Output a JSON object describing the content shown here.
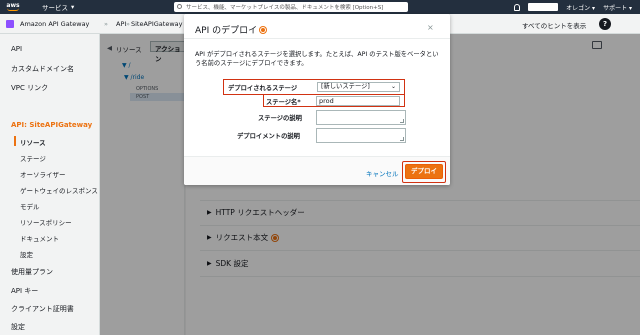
{
  "topnav": {
    "logo": "aws",
    "services": "サービス",
    "search_placeholder": "サービス、機能、マーケットプレイスの製品、ドキュメントを検索 [Option+S]",
    "support": "サポート",
    "region": "オレゴン"
  },
  "breadcrumb": {
    "service": "Amazon API Gateway",
    "api": "API",
    "separator": "»",
    "api_name": "SiteAPIGateway (e",
    "hints": "すべてのヒントを表示",
    "help": "?"
  },
  "sidebar": {
    "items": [
      {
        "label": "API"
      },
      {
        "label": "カスタムドメイン名"
      },
      {
        "label": "VPC リンク"
      }
    ],
    "api_heading": "API: SiteAPIGateway",
    "sub_items": [
      {
        "label": "リソース"
      },
      {
        "label": "ステージ"
      },
      {
        "label": "オーソライザー"
      },
      {
        "label": "ゲートウェイのレスポンス"
      },
      {
        "label": "モデル"
      },
      {
        "label": "リソースポリシー"
      },
      {
        "label": "ドキュメント"
      },
      {
        "label": "設定"
      }
    ],
    "bottom_items": [
      {
        "label": "使用量プラン"
      },
      {
        "label": "API キー"
      },
      {
        "label": "クライアント証明書"
      },
      {
        "label": "設定"
      }
    ]
  },
  "resources": {
    "tab": "リソース",
    "collapse": "◀",
    "actions": "アクション",
    "tree": [
      {
        "label": "▼ /"
      },
      {
        "label": "▼ /ride"
      }
    ],
    "methods": [
      "OPTIONS",
      "POST"
    ]
  },
  "main": {
    "sections": [
      {
        "label": "HTTP リクエストヘッダー",
        "info": false
      },
      {
        "label": "リクエスト本文",
        "info": true
      },
      {
        "label": "SDK 設定",
        "info": false
      }
    ],
    "caret": "▶"
  },
  "modal": {
    "title": "API のデプロイ",
    "close": "×",
    "description": "API がデプロイされるステージを選択します。たとえば、API のテスト版をベータという名前のステージにデプロイできます。",
    "stage_label": "デプロイされるステージ",
    "stage_value": "[新しいステージ]",
    "stage_name_label": "ステージ名*",
    "stage_name_value": "prod",
    "stage_desc_label": "ステージの説明",
    "deploy_desc_label": "デプロイメントの説明",
    "cancel": "キャンセル",
    "deploy": "デプロイ"
  },
  "colors": {
    "accent": "#ec7211",
    "highlight": "#d13212",
    "link": "#0073bb",
    "navbar": "#232f3e"
  }
}
